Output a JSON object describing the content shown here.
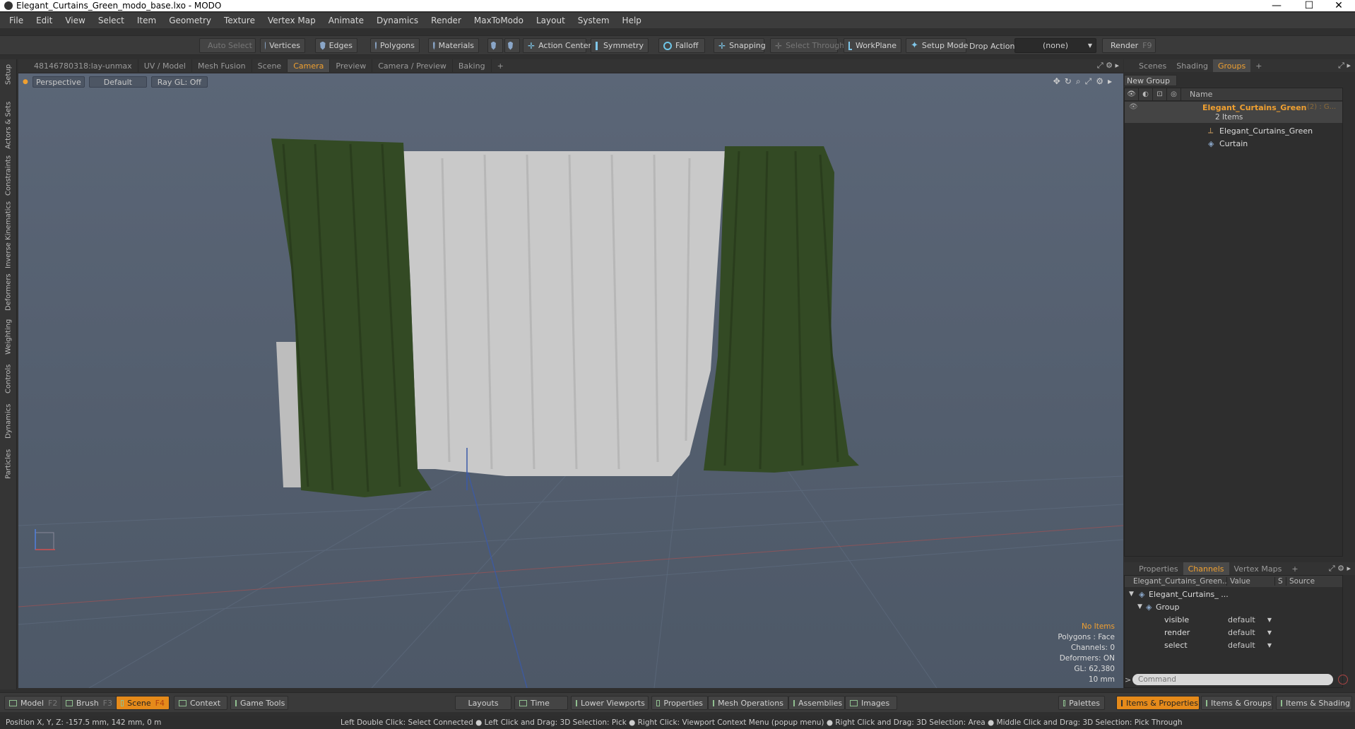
{
  "window": {
    "title": "Elegant_Curtains_Green_modo_base.lxo - MODO",
    "minimize": "—",
    "maximize": "☐",
    "close": "✕"
  },
  "menu": [
    "File",
    "Edit",
    "View",
    "Select",
    "Item",
    "Geometry",
    "Texture",
    "Vertex Map",
    "Animate",
    "Dynamics",
    "Render",
    "MaxToModo",
    "Layout",
    "System",
    "Help"
  ],
  "toolbar": {
    "auto_select": "Auto Select",
    "vertices": "Vertices",
    "edges": "Edges",
    "polygons": "Polygons",
    "materials": "Materials",
    "action_center": "Action Center",
    "symmetry": "Symmetry",
    "falloff": "Falloff",
    "snapping": "Snapping",
    "select_through": "Select Through",
    "workplane": "WorkPlane",
    "setup_mode": "Setup Mode",
    "drop_action": "Drop Action",
    "drop_value": "(none)",
    "render": "Render",
    "render_key": "F9"
  },
  "left_tabs": [
    "Setup",
    "Actors & Sets",
    "Constraints",
    "Inverse Kinematics",
    "Deformers",
    "Weighting",
    "Controls",
    "Dynamics",
    "Particles"
  ],
  "viewport_tabs": [
    "48146780318:lay-unmax",
    "UV / Model",
    "Mesh Fusion",
    "Scene",
    "Camera",
    "Preview",
    "Camera / Preview",
    "Baking",
    "+"
  ],
  "active_viewport_tab": "Camera",
  "viewport": {
    "view_mode": "Perspective",
    "style": "Default",
    "raygl": "Ray GL: Off"
  },
  "viewport_info": {
    "items": "No Items",
    "polygons": "Polygons : Face",
    "channels": "Channels: 0",
    "deformers": "Deformers: ON",
    "gl": "GL: 62,380",
    "unit": "10 mm"
  },
  "right_tabs": [
    "Scenes",
    "Shading",
    "Groups",
    "+"
  ],
  "active_right_tab": "Groups",
  "groups": {
    "new_group": "New Group",
    "column_name": "Name",
    "root": "Elegant_Curtains_Green",
    "root_suffix": "(2) : G...",
    "items_count": "2 Items",
    "children": [
      "Elegant_Curtains_Green",
      "Curtain"
    ]
  },
  "lower_tabs": [
    "Properties",
    "Channels",
    "Vertex Maps",
    "+"
  ],
  "active_lower_tab": "Channels",
  "channels": {
    "headers": [
      "Elegant_Curtains_Green...",
      "Value",
      "S",
      "Source"
    ],
    "root": "Elegant_Curtains_ ...",
    "group": "Group",
    "rows": [
      {
        "name": "visible",
        "value": "default"
      },
      {
        "name": "render",
        "value": "default"
      },
      {
        "name": "select",
        "value": "default"
      }
    ]
  },
  "command_placeholder": "Command",
  "bottom": {
    "model": "Model",
    "model_key": "F2",
    "brush": "Brush",
    "brush_key": "F3",
    "scene": "Scene",
    "scene_key": "F4",
    "context": "Context",
    "game_tools": "Game Tools",
    "layouts": "Layouts",
    "time": "Time",
    "lower_viewports": "Lower Viewports",
    "properties": "Properties",
    "mesh_operations": "Mesh Operations",
    "assemblies": "Assemblies",
    "images": "Images",
    "palettes": "Palettes",
    "items_properties": "Items & Properties",
    "items_groups": "Items & Groups",
    "items_shading": "Items & Shading"
  },
  "status": {
    "position": "Position X, Y, Z:   -157.5 mm, 142 mm, 0 m",
    "hints": "Left Double Click: Select Connected ● Left Click and Drag: 3D Selection: Pick ● Right Click: Viewport Context Menu (popup menu) ● Right Click and Drag: 3D Selection: Area ● Middle Click and Drag: 3D Selection: Pick Through"
  },
  "colors": {
    "accent": "#f0a030",
    "curtain_green": "#334a24",
    "curtain_white": "#c9c9c9",
    "viewport_bg": "#56606f"
  }
}
